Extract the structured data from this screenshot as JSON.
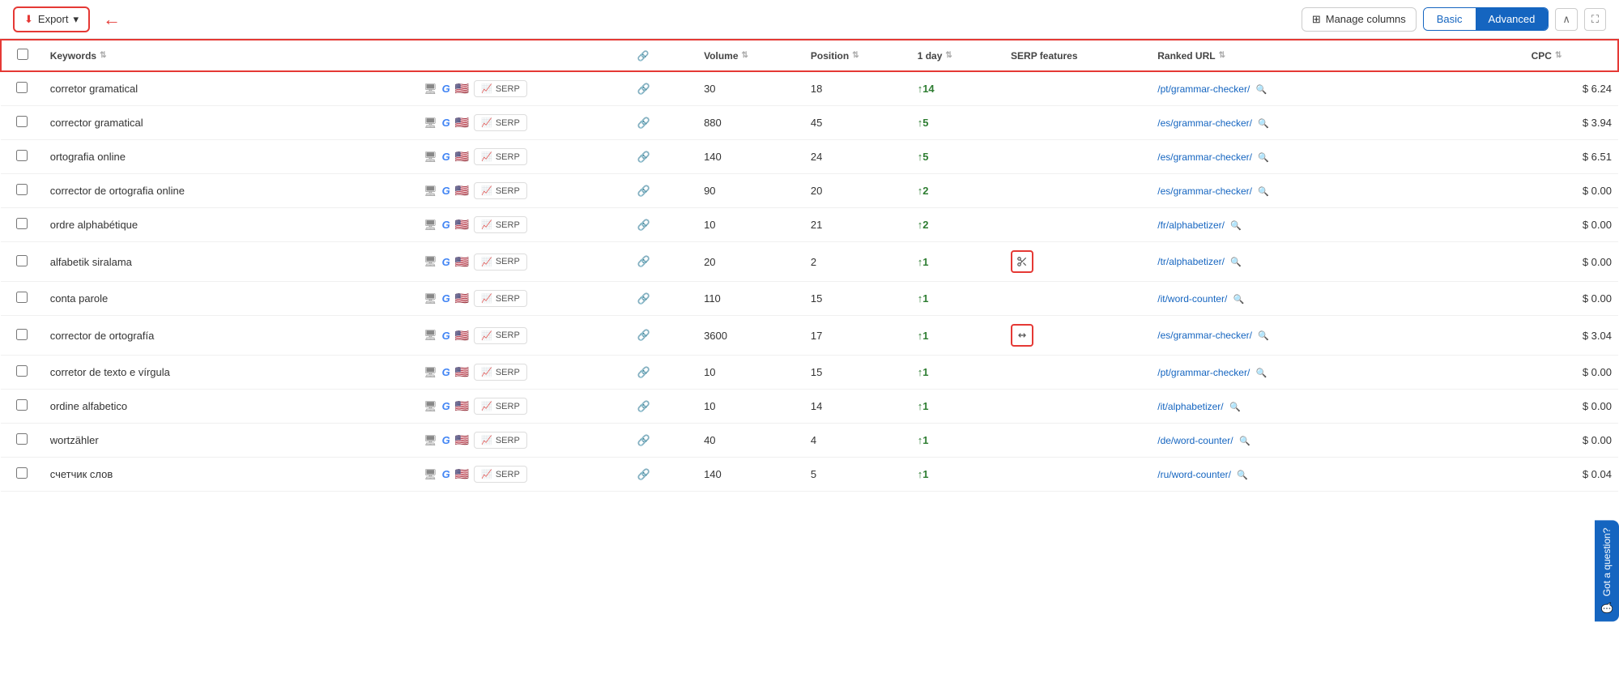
{
  "toolbar": {
    "export_label": "Export",
    "manage_columns_label": "Manage columns",
    "basic_label": "Basic",
    "advanced_label": "Advanced",
    "collapse_icon": "∧",
    "expand_icon": "⛶"
  },
  "table": {
    "columns": {
      "keywords": "Keywords",
      "volume": "Volume",
      "position": "Position",
      "one_day": "1 day",
      "serp_features": "SERP features",
      "ranked_url": "Ranked URL",
      "cpc": "CPC"
    },
    "rows": [
      {
        "keyword": "corretor gramatical",
        "volume": "30",
        "position": "18",
        "change": "14",
        "ranked_url": "/pt/grammar-checker/",
        "cpc": "$ 6.24",
        "serp_icon": null
      },
      {
        "keyword": "corrector gramatical",
        "volume": "880",
        "position": "45",
        "change": "5",
        "ranked_url": "/es/grammar-checker/",
        "cpc": "$ 3.94",
        "serp_icon": null
      },
      {
        "keyword": "ortografia online",
        "volume": "140",
        "position": "24",
        "change": "5",
        "ranked_url": "/es/grammar-checker/",
        "cpc": "$ 6.51",
        "serp_icon": null
      },
      {
        "keyword": "corrector de ortografia online",
        "volume": "90",
        "position": "20",
        "change": "2",
        "ranked_url": "/es/grammar-checker/",
        "cpc": "$ 0.00",
        "serp_icon": null
      },
      {
        "keyword": "ordre alphabétique",
        "volume": "10",
        "position": "21",
        "change": "2",
        "ranked_url": "/fr/alphabetizer/",
        "cpc": "$ 0.00",
        "serp_icon": null
      },
      {
        "keyword": "alfabetik siralama",
        "volume": "20",
        "position": "2",
        "change": "1",
        "ranked_url": "/tr/alphabetizer/",
        "cpc": "$ 0.00",
        "serp_icon": "scissors"
      },
      {
        "keyword": "conta parole",
        "volume": "110",
        "position": "15",
        "change": "1",
        "ranked_url": "/it/word-counter/",
        "cpc": "$ 0.00",
        "serp_icon": null
      },
      {
        "keyword": "corrector de ortografía",
        "volume": "3600",
        "position": "17",
        "change": "1",
        "ranked_url": "/es/grammar-checker/",
        "cpc": "$ 3.04",
        "serp_icon": "arrows"
      },
      {
        "keyword": "corretor de texto e vírgula",
        "volume": "10",
        "position": "15",
        "change": "1",
        "ranked_url": "/pt/grammar-checker/",
        "cpc": "$ 0.00",
        "serp_icon": null
      },
      {
        "keyword": "ordine alfabetico",
        "volume": "10",
        "position": "14",
        "change": "1",
        "ranked_url": "/it/alphabetizer/",
        "cpc": "$ 0.00",
        "serp_icon": null
      },
      {
        "keyword": "wortzähler",
        "volume": "40",
        "position": "4",
        "change": "1",
        "ranked_url": "/de/word-counter/",
        "cpc": "$ 0.00",
        "serp_icon": null
      },
      {
        "keyword": "счетчик слов",
        "volume": "140",
        "position": "5",
        "change": "1",
        "ranked_url": "/ru/word-counter/",
        "cpc": "$ 0.04",
        "serp_icon": null
      }
    ]
  },
  "chat_widget": {
    "label": "Got a question?"
  }
}
